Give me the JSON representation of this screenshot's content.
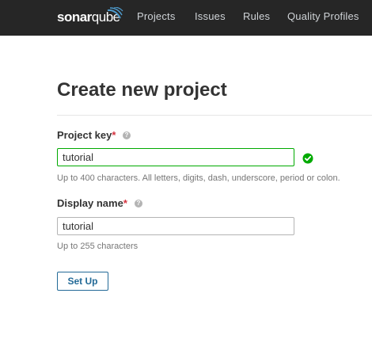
{
  "navbar": {
    "logo": {
      "text_bold": "sonar",
      "text_regular": "qube"
    },
    "links": [
      "Projects",
      "Issues",
      "Rules",
      "Quality Profiles"
    ]
  },
  "page": {
    "title": "Create new project"
  },
  "form": {
    "project_key": {
      "label": "Project key",
      "required_marker": "*",
      "help_icon": "question-circle-icon",
      "value": "tutorial",
      "status_icon": "check-circle-icon",
      "hint": "Up to 400 characters. All letters, digits, dash, underscore, period or colon."
    },
    "display_name": {
      "label": "Display name",
      "required_marker": "*",
      "help_icon": "question-circle-icon",
      "value": "tutorial",
      "hint": "Up to 255 characters"
    },
    "submit_label": "Set Up"
  },
  "colors": {
    "navbar_bg": "#262626",
    "valid_green": "#00aa00",
    "required_red": "#d4333f",
    "button_blue": "#236a97",
    "logo_wave_blue": "#4e9bcd"
  }
}
